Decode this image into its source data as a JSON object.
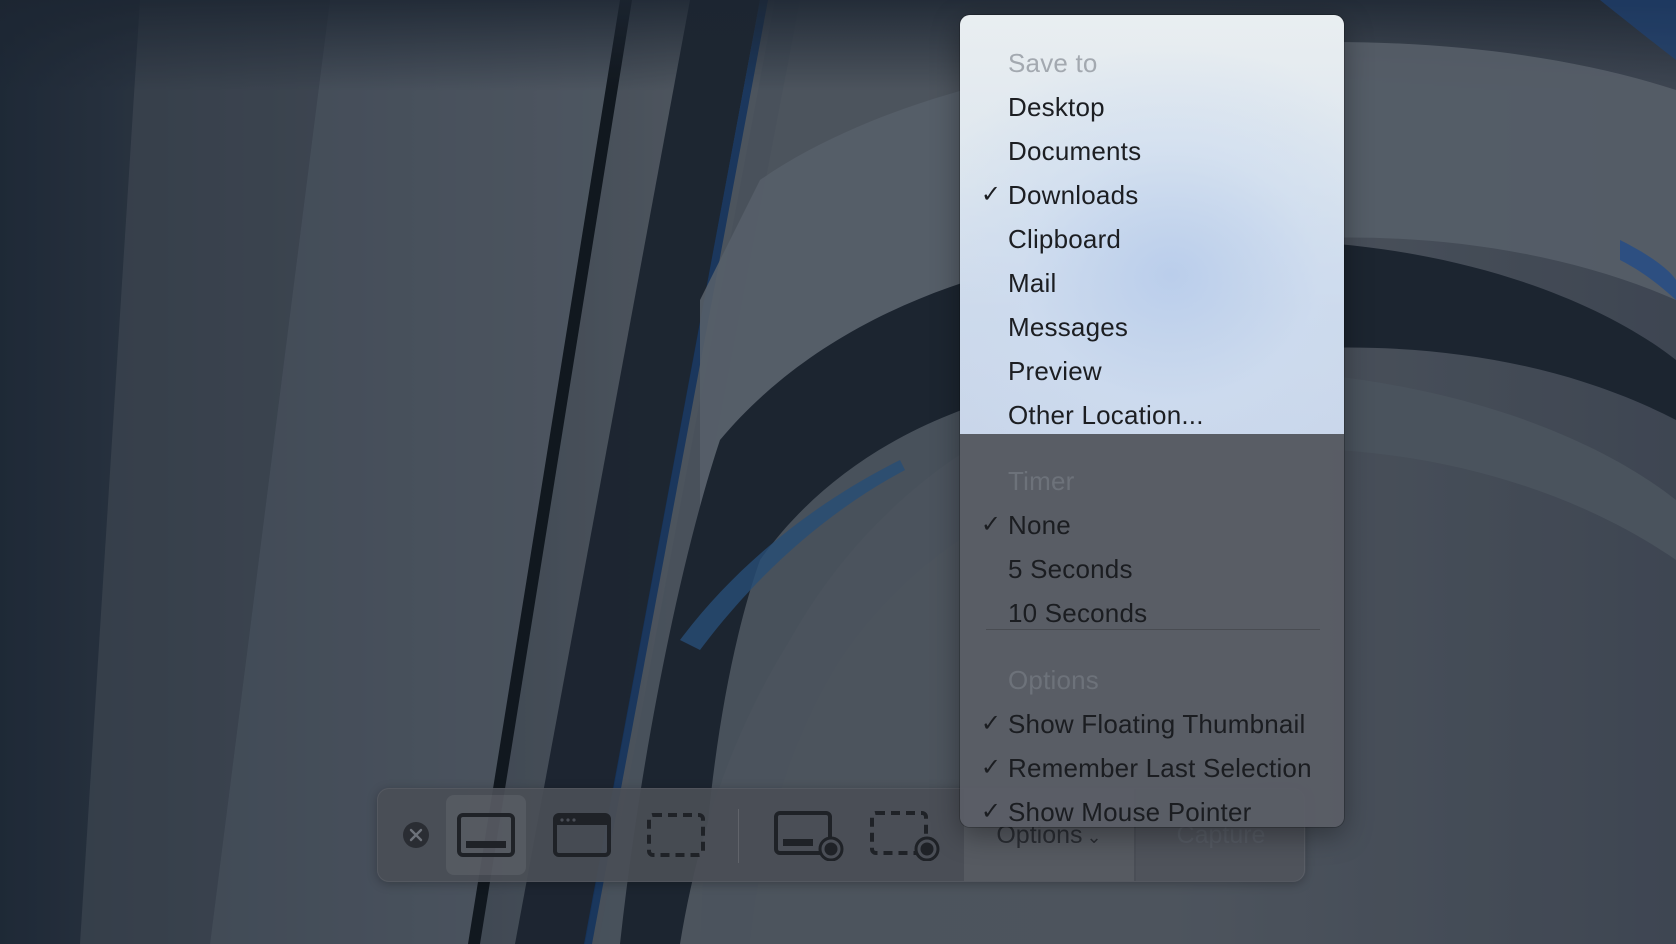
{
  "colors": {
    "menu_highlight": "#d6e0ee",
    "menu_dark": "#5a5e66",
    "toolbar_bg": "#4a4e56",
    "header_text": "#a3a9b0"
  },
  "menu": {
    "save_to": {
      "header": "Save to",
      "items": [
        {
          "label": "Desktop",
          "checked": false
        },
        {
          "label": "Documents",
          "checked": false
        },
        {
          "label": "Downloads",
          "checked": true
        },
        {
          "label": "Clipboard",
          "checked": false
        },
        {
          "label": "Mail",
          "checked": false
        },
        {
          "label": "Messages",
          "checked": false
        },
        {
          "label": "Preview",
          "checked": false
        },
        {
          "label": "Other Location...",
          "checked": false
        }
      ]
    },
    "timer": {
      "header": "Timer",
      "items": [
        {
          "label": "None",
          "checked": true
        },
        {
          "label": "5 Seconds",
          "checked": false
        },
        {
          "label": "10 Seconds",
          "checked": false
        }
      ]
    },
    "options": {
      "header": "Options",
      "items": [
        {
          "label": "Show Floating Thumbnail",
          "checked": true
        },
        {
          "label": "Remember Last Selection",
          "checked": true
        },
        {
          "label": "Show Mouse Pointer",
          "checked": true
        }
      ]
    },
    "check_glyph": "✓"
  },
  "toolbar": {
    "close_icon": "close-icon",
    "tools": [
      {
        "icon": "capture-entire-screen-icon",
        "selected": true
      },
      {
        "icon": "capture-window-icon",
        "selected": false
      },
      {
        "icon": "capture-selection-icon",
        "selected": false
      },
      {
        "icon": "record-entire-screen-icon",
        "selected": false
      },
      {
        "icon": "record-selection-icon",
        "selected": false
      }
    ],
    "options_label": "Options",
    "options_chevron": "⌄",
    "capture_label": "Capture"
  }
}
